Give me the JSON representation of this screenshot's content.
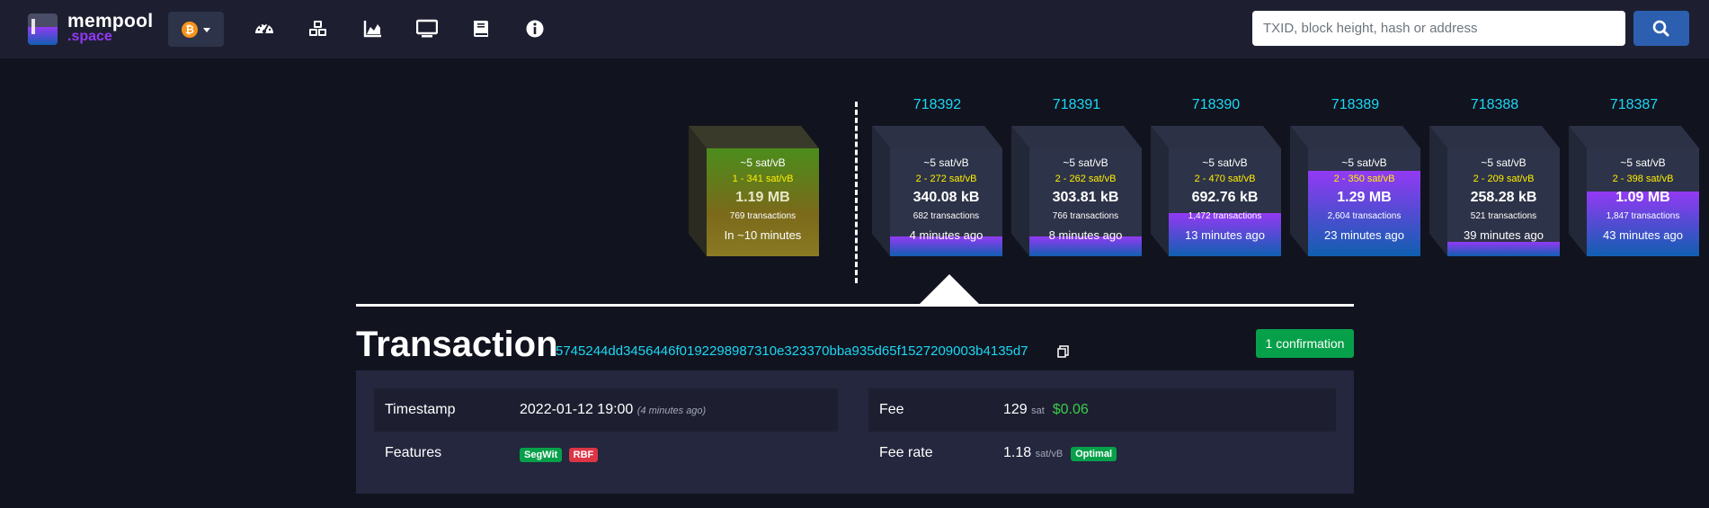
{
  "brand": {
    "name_main": "mempool",
    "name_sub": ".space"
  },
  "network": {
    "coin_symbol": "₿",
    "icon": "bitcoin-icon"
  },
  "nav": {
    "icons": [
      "dashboard-icon",
      "blocks-icon",
      "graphs-icon",
      "tv-icon",
      "docs-icon",
      "about-icon"
    ]
  },
  "search": {
    "placeholder": "TXID, block height, hash or address"
  },
  "colors": {
    "accent": "#1bd8f4",
    "purple": "#9339f4",
    "blue": "#105fb0",
    "green": "#07a04a",
    "red": "#dc3545"
  },
  "mempool_block": {
    "fee_median": "~5 sat/vB",
    "fee_range": "1 - 341 sat/vB",
    "size": "1.19 MB",
    "tx_count": "769 transactions",
    "eta": "In ~10 minutes"
  },
  "blocks": [
    {
      "height": "718392",
      "fee_median": "~5 sat/vB",
      "fee_range": "2 - 272 sat/vB",
      "size": "340.08 kB",
      "tx_count": "682 transactions",
      "time": "4 minutes ago",
      "fill_fraction": 0.18
    },
    {
      "height": "718391",
      "fee_median": "~5 sat/vB",
      "fee_range": "2 - 262 sat/vB",
      "size": "303.81 kB",
      "tx_count": "766 transactions",
      "time": "8 minutes ago",
      "fill_fraction": 0.18
    },
    {
      "height": "718390",
      "fee_median": "~5 sat/vB",
      "fee_range": "2 - 470 sat/vB",
      "size": "692.76 kB",
      "tx_count": "1,472 transactions",
      "time": "13 minutes ago",
      "fill_fraction": 0.4
    },
    {
      "height": "718389",
      "fee_median": "~5 sat/vB",
      "fee_range": "2 - 350 sat/vB",
      "size": "1.29 MB",
      "tx_count": "2,604 transactions",
      "time": "23 minutes ago",
      "fill_fraction": 0.79
    },
    {
      "height": "718388",
      "fee_median": "~5 sat/vB",
      "fee_range": "2 - 209 sat/vB",
      "size": "258.28 kB",
      "tx_count": "521 transactions",
      "time": "39 minutes ago",
      "fill_fraction": 0.13
    },
    {
      "height": "718387",
      "fee_median": "~5 sat/vB",
      "fee_range": "2 - 398 sat/vB",
      "size": "1.09 MB",
      "tx_count": "1,847 transactions",
      "time": "43 minutes ago",
      "fill_fraction": 0.6
    }
  ],
  "transaction": {
    "heading": "Transaction",
    "txid": "5745244dd3456446f0192298987310e323370bba935d65f1527209003b4135d7",
    "confirmations": "1 confirmation",
    "timestamp_label": "Timestamp",
    "timestamp_value": "2022-01-12 19:00",
    "timestamp_relative": "(4 minutes ago)",
    "features_label": "Features",
    "features": [
      "SegWit",
      "RBF"
    ],
    "fee_label": "Fee",
    "fee_sat": "129",
    "fee_sat_unit": "sat",
    "fee_usd": "$0.06",
    "feerate_label": "Fee rate",
    "feerate_value": "1.18",
    "feerate_unit": "sat/vB",
    "feerate_badge": "Optimal"
  }
}
